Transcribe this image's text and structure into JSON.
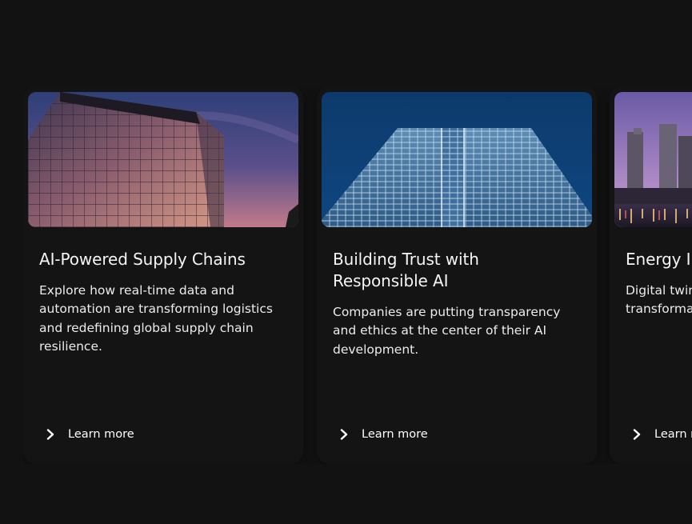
{
  "cards": [
    {
      "title": "AI-Powered Supply Chains",
      "description": "Explore how real-time data and automation are transforming logistics and redefining global supply chain resilience.",
      "link_label": "Learn more",
      "image_icon": "glass-building-sunset-photo"
    },
    {
      "title": "Building Trust with Responsible AI",
      "description": "Companies are putting transparency and ethics at the center of their AI development.",
      "link_label": "Learn more",
      "image_icon": "glass-tower-blue-photo"
    },
    {
      "title": "Energy Innovation",
      "description": "Digital twins help speed up the transformation of energy systems.",
      "link_label": "Learn more",
      "image_icon": "city-skyline-dusk-photo"
    }
  ],
  "colors": {
    "background": "#121212",
    "card": "#141414",
    "text": "#f5f5f5"
  }
}
